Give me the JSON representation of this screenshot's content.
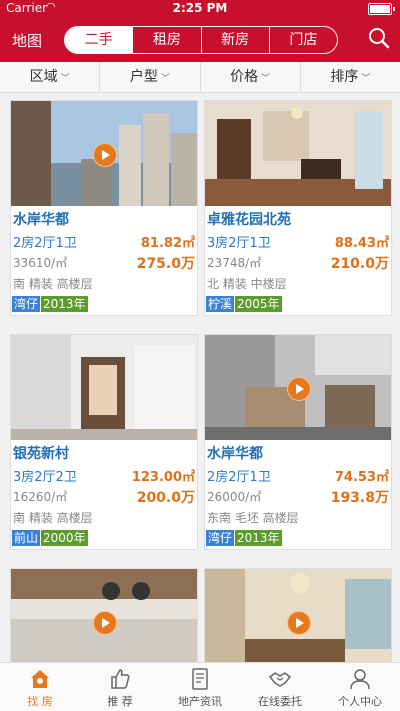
{
  "status": {
    "carrier": "Carrier",
    "time": "2:25 PM"
  },
  "header": {
    "map_label": "地图",
    "tabs": [
      {
        "label": "二手"
      },
      {
        "label": "租房"
      },
      {
        "label": "新房"
      },
      {
        "label": "门店"
      }
    ],
    "active_tab": 0
  },
  "filters": [
    {
      "label": "区域"
    },
    {
      "label": "户型"
    },
    {
      "label": "价格"
    },
    {
      "label": "排序"
    }
  ],
  "listings": [
    {
      "name": "水岸华都",
      "rooms": "2房2厅1卫",
      "area": "81.82㎡",
      "unit_price": "33610/㎡",
      "total_price": "275.0万",
      "features": "南 精装 高楼层",
      "district": "湾仔",
      "year": "2013年",
      "has_video": true
    },
    {
      "name": "卓雅花园北苑",
      "rooms": "3房2厅1卫",
      "area": "88.43㎡",
      "unit_price": "23748/㎡",
      "total_price": "210.0万",
      "features": "北 精装 中楼层",
      "district": "柠溪",
      "year": "2005年",
      "has_video": false
    },
    {
      "name": "银苑新村",
      "rooms": "3房2厅2卫",
      "area": "123.00㎡",
      "unit_price": "16260/㎡",
      "total_price": "200.0万",
      "features": "南 精装 高楼层",
      "district": "前山",
      "year": "2000年",
      "has_video": false
    },
    {
      "name": "水岸华都",
      "rooms": "2房2厅1卫",
      "area": "74.53㎡",
      "unit_price": "26000/㎡",
      "total_price": "193.8万",
      "features": "东南 毛坯 高楼层",
      "district": "湾仔",
      "year": "2013年",
      "has_video": true
    },
    {
      "has_video": true
    },
    {
      "has_video": true
    }
  ],
  "bottom_nav": [
    {
      "label": "找 房",
      "icon": "house-icon"
    },
    {
      "label": "推 荐",
      "icon": "thumbs-up-icon"
    },
    {
      "label": "地产资讯",
      "icon": "document-icon"
    },
    {
      "label": "在线委托",
      "icon": "handshake-icon"
    },
    {
      "label": "个人中心",
      "icon": "person-icon"
    }
  ],
  "colors": {
    "brand": "#c8102e",
    "accent": "#e8781c",
    "link": "#1f6fb5"
  }
}
